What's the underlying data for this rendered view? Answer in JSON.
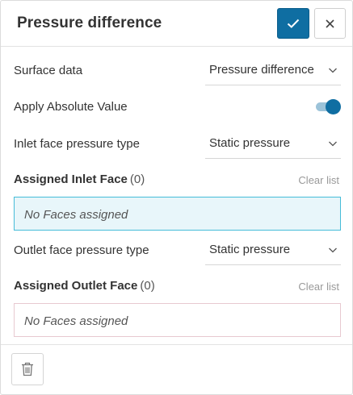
{
  "header": {
    "title": "Pressure difference",
    "confirm_icon": "check-icon",
    "close_icon": "close-icon"
  },
  "fields": {
    "surface_data": {
      "label": "Surface data",
      "value": "Pressure difference"
    },
    "apply_absolute": {
      "label": "Apply Absolute Value",
      "enabled": true
    },
    "inlet_type": {
      "label": "Inlet face pressure type",
      "value": "Static pressure"
    },
    "outlet_type": {
      "label": "Outlet face pressure type",
      "value": "Static pressure"
    }
  },
  "inlet": {
    "title": "Assigned Inlet Face",
    "count": "(0)",
    "clear": "Clear list",
    "empty": "No Faces assigned"
  },
  "outlet": {
    "title": "Assigned Outlet Face",
    "count": "(0)",
    "clear": "Clear list",
    "empty": "No Faces assigned"
  },
  "footer": {
    "delete_icon": "trash-icon"
  },
  "colors": {
    "primary": "#0f6ea2",
    "inlet_border": "#46bcd8",
    "inlet_bg": "#e8f6fa",
    "outlet_border": "#e8c9d0"
  }
}
